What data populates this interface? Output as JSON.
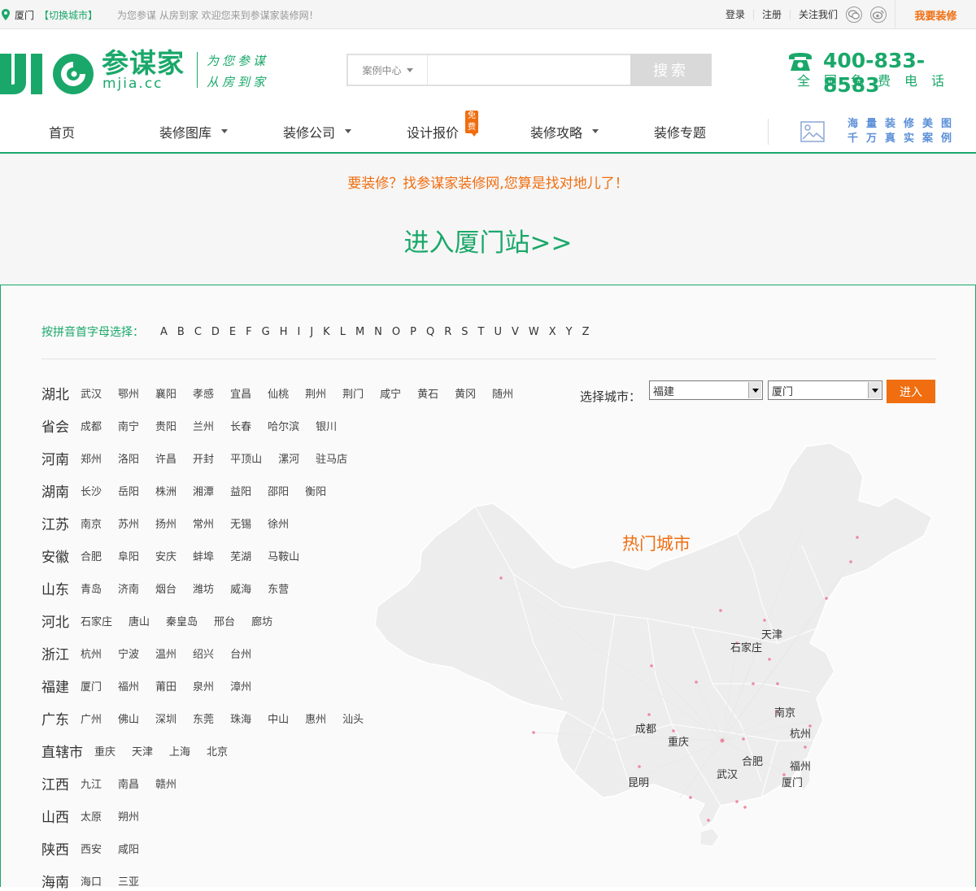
{
  "topbar": {
    "city": "厦门",
    "switch_city": "【切换城市】",
    "slogan": "为您参谋   从房到家   欢迎您来到参谋家装修网！",
    "login": "登录",
    "register": "注册",
    "follow": "关注我们",
    "want_decorate": "我要装修"
  },
  "header": {
    "logo_cn": "参谋家",
    "logo_en": "mjia.cc",
    "logo_slogan_1": "为您参谋",
    "logo_slogan_2": "从房到家",
    "search_category": "案例中心",
    "search_placeholder": "",
    "search_button": "搜索",
    "phone": "400-833-8583",
    "phone_label": "全国免费电话"
  },
  "nav": {
    "items": [
      {
        "label": "首页"
      },
      {
        "label": "装修图库"
      },
      {
        "label": "装修公司"
      },
      {
        "label": "设计报价",
        "badge": "免费"
      },
      {
        "label": "装修攻略"
      },
      {
        "label": "装修专题"
      }
    ],
    "promo_line1": "海量装修美图",
    "promo_line2": "千万真实案例"
  },
  "banner": {
    "tagline": "要装修？找参谋家装修网,您算是找对地儿了！",
    "enter_site": "进入厦门站>>"
  },
  "alphabet": {
    "label": "按拼音首字母选择：",
    "letters": [
      "A",
      "B",
      "C",
      "D",
      "E",
      "F",
      "G",
      "H",
      "I",
      "J",
      "K",
      "L",
      "M",
      "N",
      "O",
      "P",
      "Q",
      "R",
      "S",
      "T",
      "U",
      "V",
      "W",
      "X",
      "Y",
      "Z"
    ]
  },
  "provinces": [
    {
      "name": "湖北",
      "cities": [
        "武汉",
        "鄂州",
        "襄阳",
        "孝感",
        "宜昌",
        "仙桃",
        "荆州",
        "荆门",
        "咸宁",
        "黄石",
        "黄冈",
        "随州"
      ]
    },
    {
      "name": "省会",
      "cities": [
        "成都",
        "南宁",
        "贵阳",
        "兰州",
        "长春",
        "哈尔滨",
        "银川"
      ]
    },
    {
      "name": "河南",
      "cities": [
        "郑州",
        "洛阳",
        "许昌",
        "开封",
        "平顶山",
        "漯河",
        "驻马店"
      ]
    },
    {
      "name": "湖南",
      "cities": [
        "长沙",
        "岳阳",
        "株洲",
        "湘潭",
        "益阳",
        "邵阳",
        "衡阳"
      ]
    },
    {
      "name": "江苏",
      "cities": [
        "南京",
        "苏州",
        "扬州",
        "常州",
        "无锡",
        "徐州"
      ]
    },
    {
      "name": "安徽",
      "cities": [
        "合肥",
        "阜阳",
        "安庆",
        "蚌埠",
        "芜湖",
        "马鞍山"
      ]
    },
    {
      "name": "山东",
      "cities": [
        "青岛",
        "济南",
        "烟台",
        "潍坊",
        "威海",
        "东营"
      ]
    },
    {
      "name": "河北",
      "cities": [
        "石家庄",
        "唐山",
        "秦皇岛",
        "邢台",
        "廊坊"
      ]
    },
    {
      "name": "浙江",
      "cities": [
        "杭州",
        "宁波",
        "温州",
        "绍兴",
        "台州"
      ]
    },
    {
      "name": "福建",
      "cities": [
        "厦门",
        "福州",
        "莆田",
        "泉州",
        "漳州"
      ]
    },
    {
      "name": "广东",
      "cities": [
        "广州",
        "佛山",
        "深圳",
        "东莞",
        "珠海",
        "中山",
        "惠州",
        "汕头"
      ]
    },
    {
      "name": "直辖市",
      "cities": [
        "重庆",
        "天津",
        "上海",
        "北京"
      ]
    },
    {
      "name": "江西",
      "cities": [
        "九江",
        "南昌",
        "赣州"
      ]
    },
    {
      "name": "山西",
      "cities": [
        "太原",
        "朔州"
      ]
    },
    {
      "name": "陕西",
      "cities": [
        "西安",
        "咸阳"
      ]
    },
    {
      "name": "海南",
      "cities": [
        "海口",
        "三亚"
      ]
    }
  ],
  "city_select": {
    "label": "选择城市：",
    "province_value": "福建",
    "city_value": "厦门",
    "enter_button": "进入"
  },
  "hot_map": {
    "title": "热门城市",
    "cities": [
      "天津",
      "石家庄",
      "南京",
      "成都",
      "重庆",
      "杭州",
      "合肥",
      "福州",
      "武汉",
      "昆明",
      "厦门"
    ]
  },
  "colors": {
    "brand_green": "#1aa86a",
    "accent_orange": "#f06e10"
  }
}
